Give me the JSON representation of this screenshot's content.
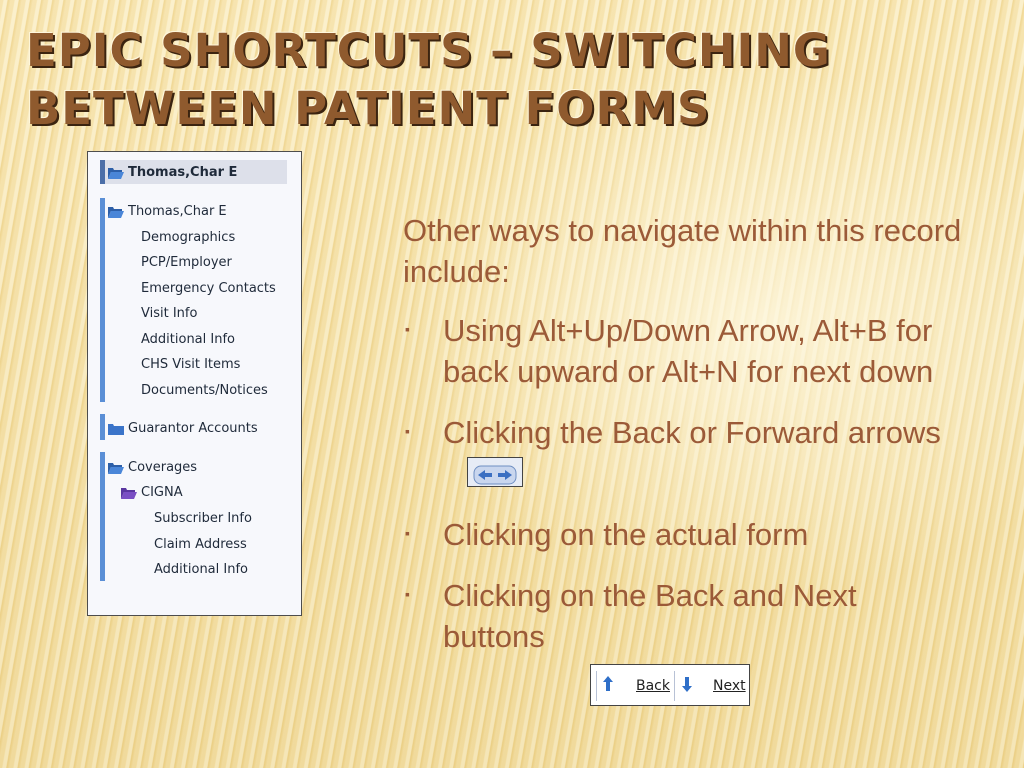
{
  "slide": {
    "title": "Epic Shortcuts – Switching between Patient Forms"
  },
  "tree": {
    "selected_label": "Thomas,Char E",
    "patient_label": "Thomas,Char E",
    "patient_items": [
      "Demographics",
      "PCP/Employer",
      "Emergency Contacts",
      "Visit Info",
      "Additional Info",
      "CHS Visit Items",
      "Documents/Notices"
    ],
    "guarantor_label": "Guarantor Accounts",
    "coverages_label": "Coverages",
    "cigna_label": "CIGNA",
    "cigna_items": [
      "Subscriber Info",
      "Claim Address",
      "Additional Info"
    ],
    "colors": {
      "accent": "#5b8fd6",
      "folder": "#3b74c9",
      "folder_purple": "#7a4fc4"
    }
  },
  "content": {
    "intro": "Other ways to navigate within this record include:",
    "bullets": [
      "Using Alt+Up/Down Arrow, Alt+B for back upward or Alt+N for next down",
      "Clicking the Back or Forward arrows",
      "Clicking on the actual form",
      "Clicking on the Back and Next buttons"
    ],
    "bullet_marker": "▪"
  },
  "navbar": {
    "back_label": "Back",
    "next_label": "Next",
    "up_icon": "up-arrow-icon",
    "down_icon": "down-arrow-icon"
  },
  "colors": {
    "title": "#8f5a2e",
    "text": "#9b5a38"
  }
}
